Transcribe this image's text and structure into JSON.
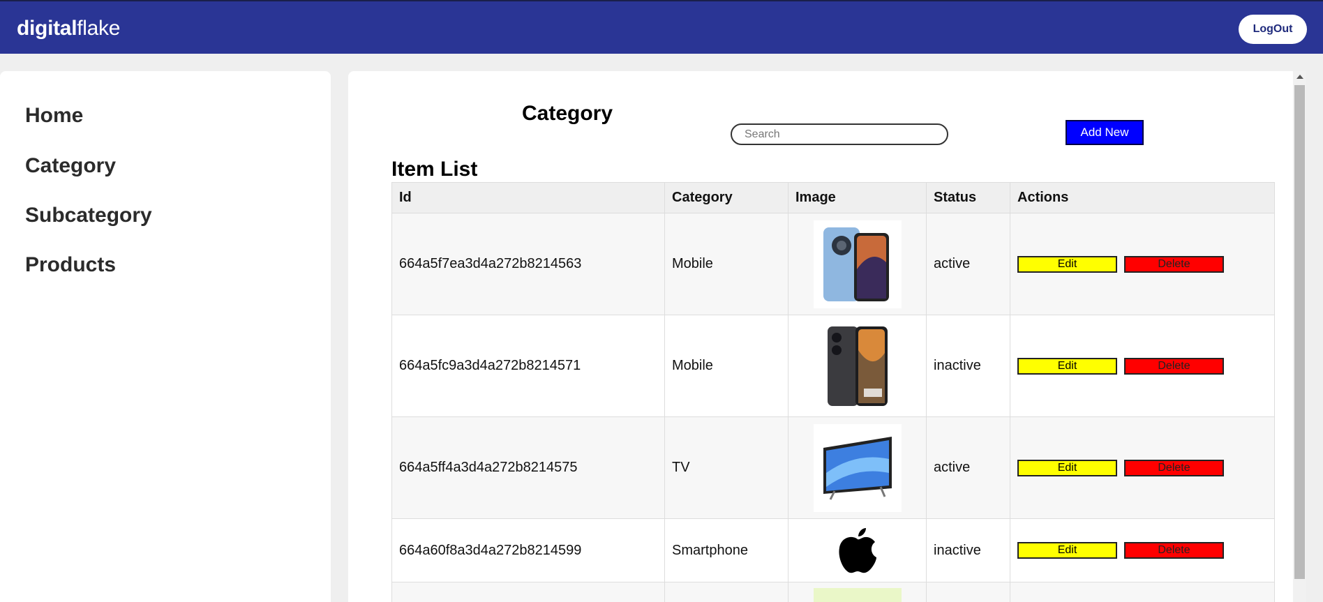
{
  "header": {
    "brand_bold": "digital",
    "brand_regular": "flake",
    "logout_label": "LogOut"
  },
  "sidebar": {
    "items": [
      {
        "label": "Home"
      },
      {
        "label": "Category"
      },
      {
        "label": "Subcategory"
      },
      {
        "label": "Products"
      }
    ]
  },
  "main": {
    "title": "Category",
    "search_placeholder": "Search",
    "add_new_label": "Add New",
    "list_title": "Item List",
    "columns": [
      "Id",
      "Category",
      "Image",
      "Status",
      "Actions"
    ],
    "rows": [
      {
        "id": "664a5f7ea3d4a272b8214563",
        "category": "Mobile",
        "image_icon": "phone-blue-image",
        "status": "active",
        "edit": "Edit",
        "delete": "Delete"
      },
      {
        "id": "664a5fc9a3d4a272b8214571",
        "category": "Mobile",
        "image_icon": "phone-black-image",
        "status": "inactive",
        "edit": "Edit",
        "delete": "Delete"
      },
      {
        "id": "664a5ff4a3d4a272b8214575",
        "category": "TV",
        "image_icon": "tv-image",
        "status": "active",
        "edit": "Edit",
        "delete": "Delete"
      },
      {
        "id": "664a60f8a3d4a272b8214599",
        "category": "Smartphone",
        "image_icon": "apple-logo-image",
        "status": "inactive",
        "edit": "Edit",
        "delete": "Delete"
      }
    ]
  },
  "colors": {
    "header_bg": "#2a3595",
    "add_new_bg": "#0000ff",
    "edit_bg": "#ffff00",
    "delete_bg": "#ff0000"
  }
}
